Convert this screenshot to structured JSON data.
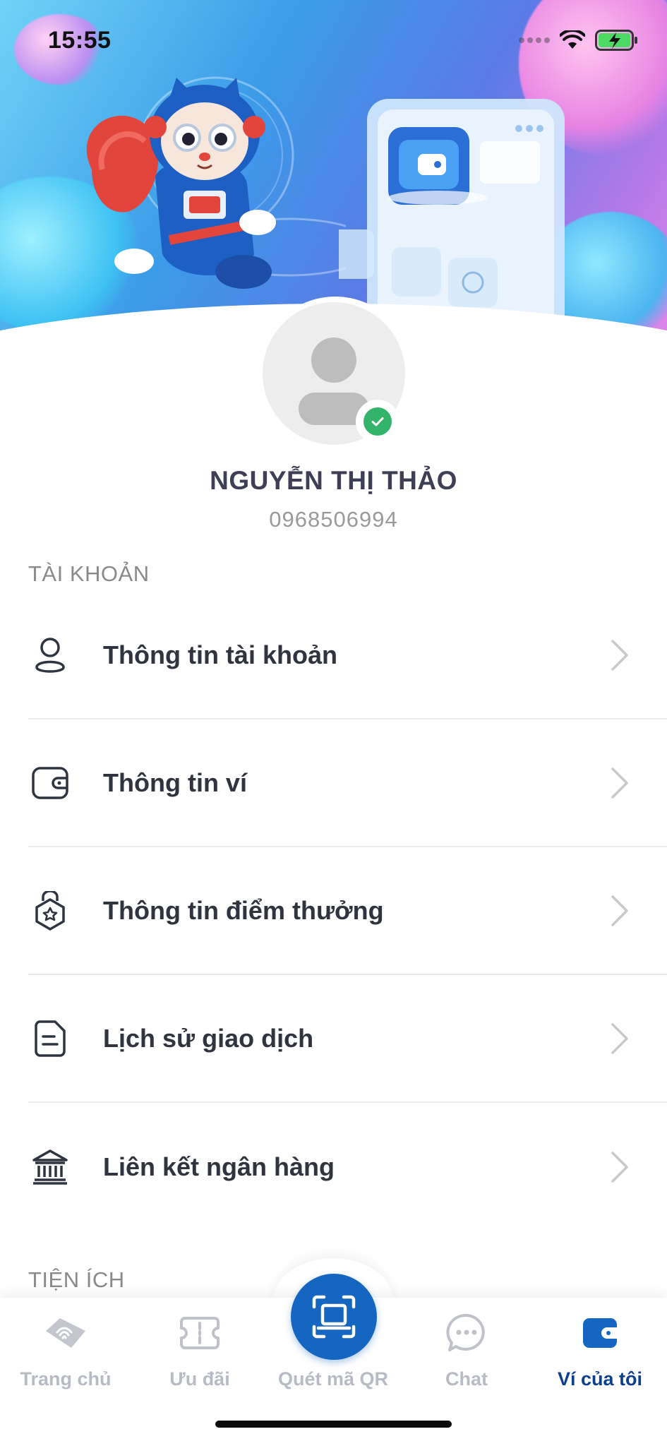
{
  "status_bar": {
    "time": "15:55"
  },
  "profile": {
    "name": "NGUYỄN THỊ THẢO",
    "phone": "0968506994"
  },
  "sections": {
    "account_title": "TÀI KHOẢN",
    "utilities_title": "TIỆN ÍCH"
  },
  "menu": {
    "items": [
      {
        "label": "Thông tin tài khoản",
        "icon": "user-icon"
      },
      {
        "label": "Thông tin ví",
        "icon": "wallet-icon"
      },
      {
        "label": "Thông tin điểm thưởng",
        "icon": "reward-points-icon"
      },
      {
        "label": "Lịch sử giao dịch",
        "icon": "transaction-history-icon"
      },
      {
        "label": "Liên kết ngân hàng",
        "icon": "bank-icon"
      }
    ]
  },
  "bottom_nav": {
    "items": [
      {
        "label": "Trang chủ",
        "icon": "home-icon",
        "active": false
      },
      {
        "label": "Ưu đãi",
        "icon": "ticket-icon",
        "active": false
      },
      {
        "label": "Quét mã QR",
        "icon": "qr-scan-icon",
        "active": false
      },
      {
        "label": "Chat",
        "icon": "chat-icon",
        "active": false
      },
      {
        "label": "Ví của tôi",
        "icon": "wallet-icon",
        "active": true
      }
    ]
  },
  "colors": {
    "accent": "#1566c0",
    "active_nav": "#0e3f8c",
    "inactive_nav": "#b7bcc4",
    "verified": "#34b36b"
  }
}
